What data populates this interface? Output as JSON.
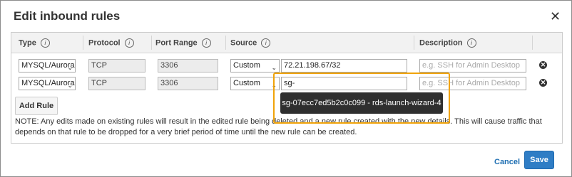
{
  "dialog": {
    "title": "Edit inbound rules",
    "close_icon": "close-icon"
  },
  "table": {
    "headers": [
      "Type",
      "Protocol",
      "Port Range",
      "Source",
      "Description"
    ],
    "rows": [
      {
        "type": "MYSQL/Aurora",
        "protocol": "TCP",
        "port_range": "3306",
        "source_mode": "Custom",
        "source_value": "72.21.198.67/32",
        "description_placeholder": "e.g. SSH for Admin Desktop"
      },
      {
        "type": "MYSQL/Aurora",
        "protocol": "TCP",
        "port_range": "3306",
        "source_mode": "Custom",
        "source_value": "sg-",
        "description_placeholder": "e.g. SSH for Admin Desktop"
      }
    ]
  },
  "autocomplete": {
    "suggestion": "sg-07ecc7ed5b2c0c099 - rds-launch-wizard-4"
  },
  "add_rule_label": "Add Rule",
  "note": "NOTE: Any edits made on existing rules will result in the edited rule being deleted and a new rule created with the new details. This will cause traffic that depends on that rule to be dropped for a very brief period of time until the new rule can be created.",
  "footer": {
    "cancel_label": "Cancel",
    "save_label": "Save"
  },
  "colors": {
    "highlight": "#f0a30a",
    "save_button": "#2f7dc5",
    "link": "#1f6fb2",
    "dropdown_bg": "#2f2f2f"
  }
}
